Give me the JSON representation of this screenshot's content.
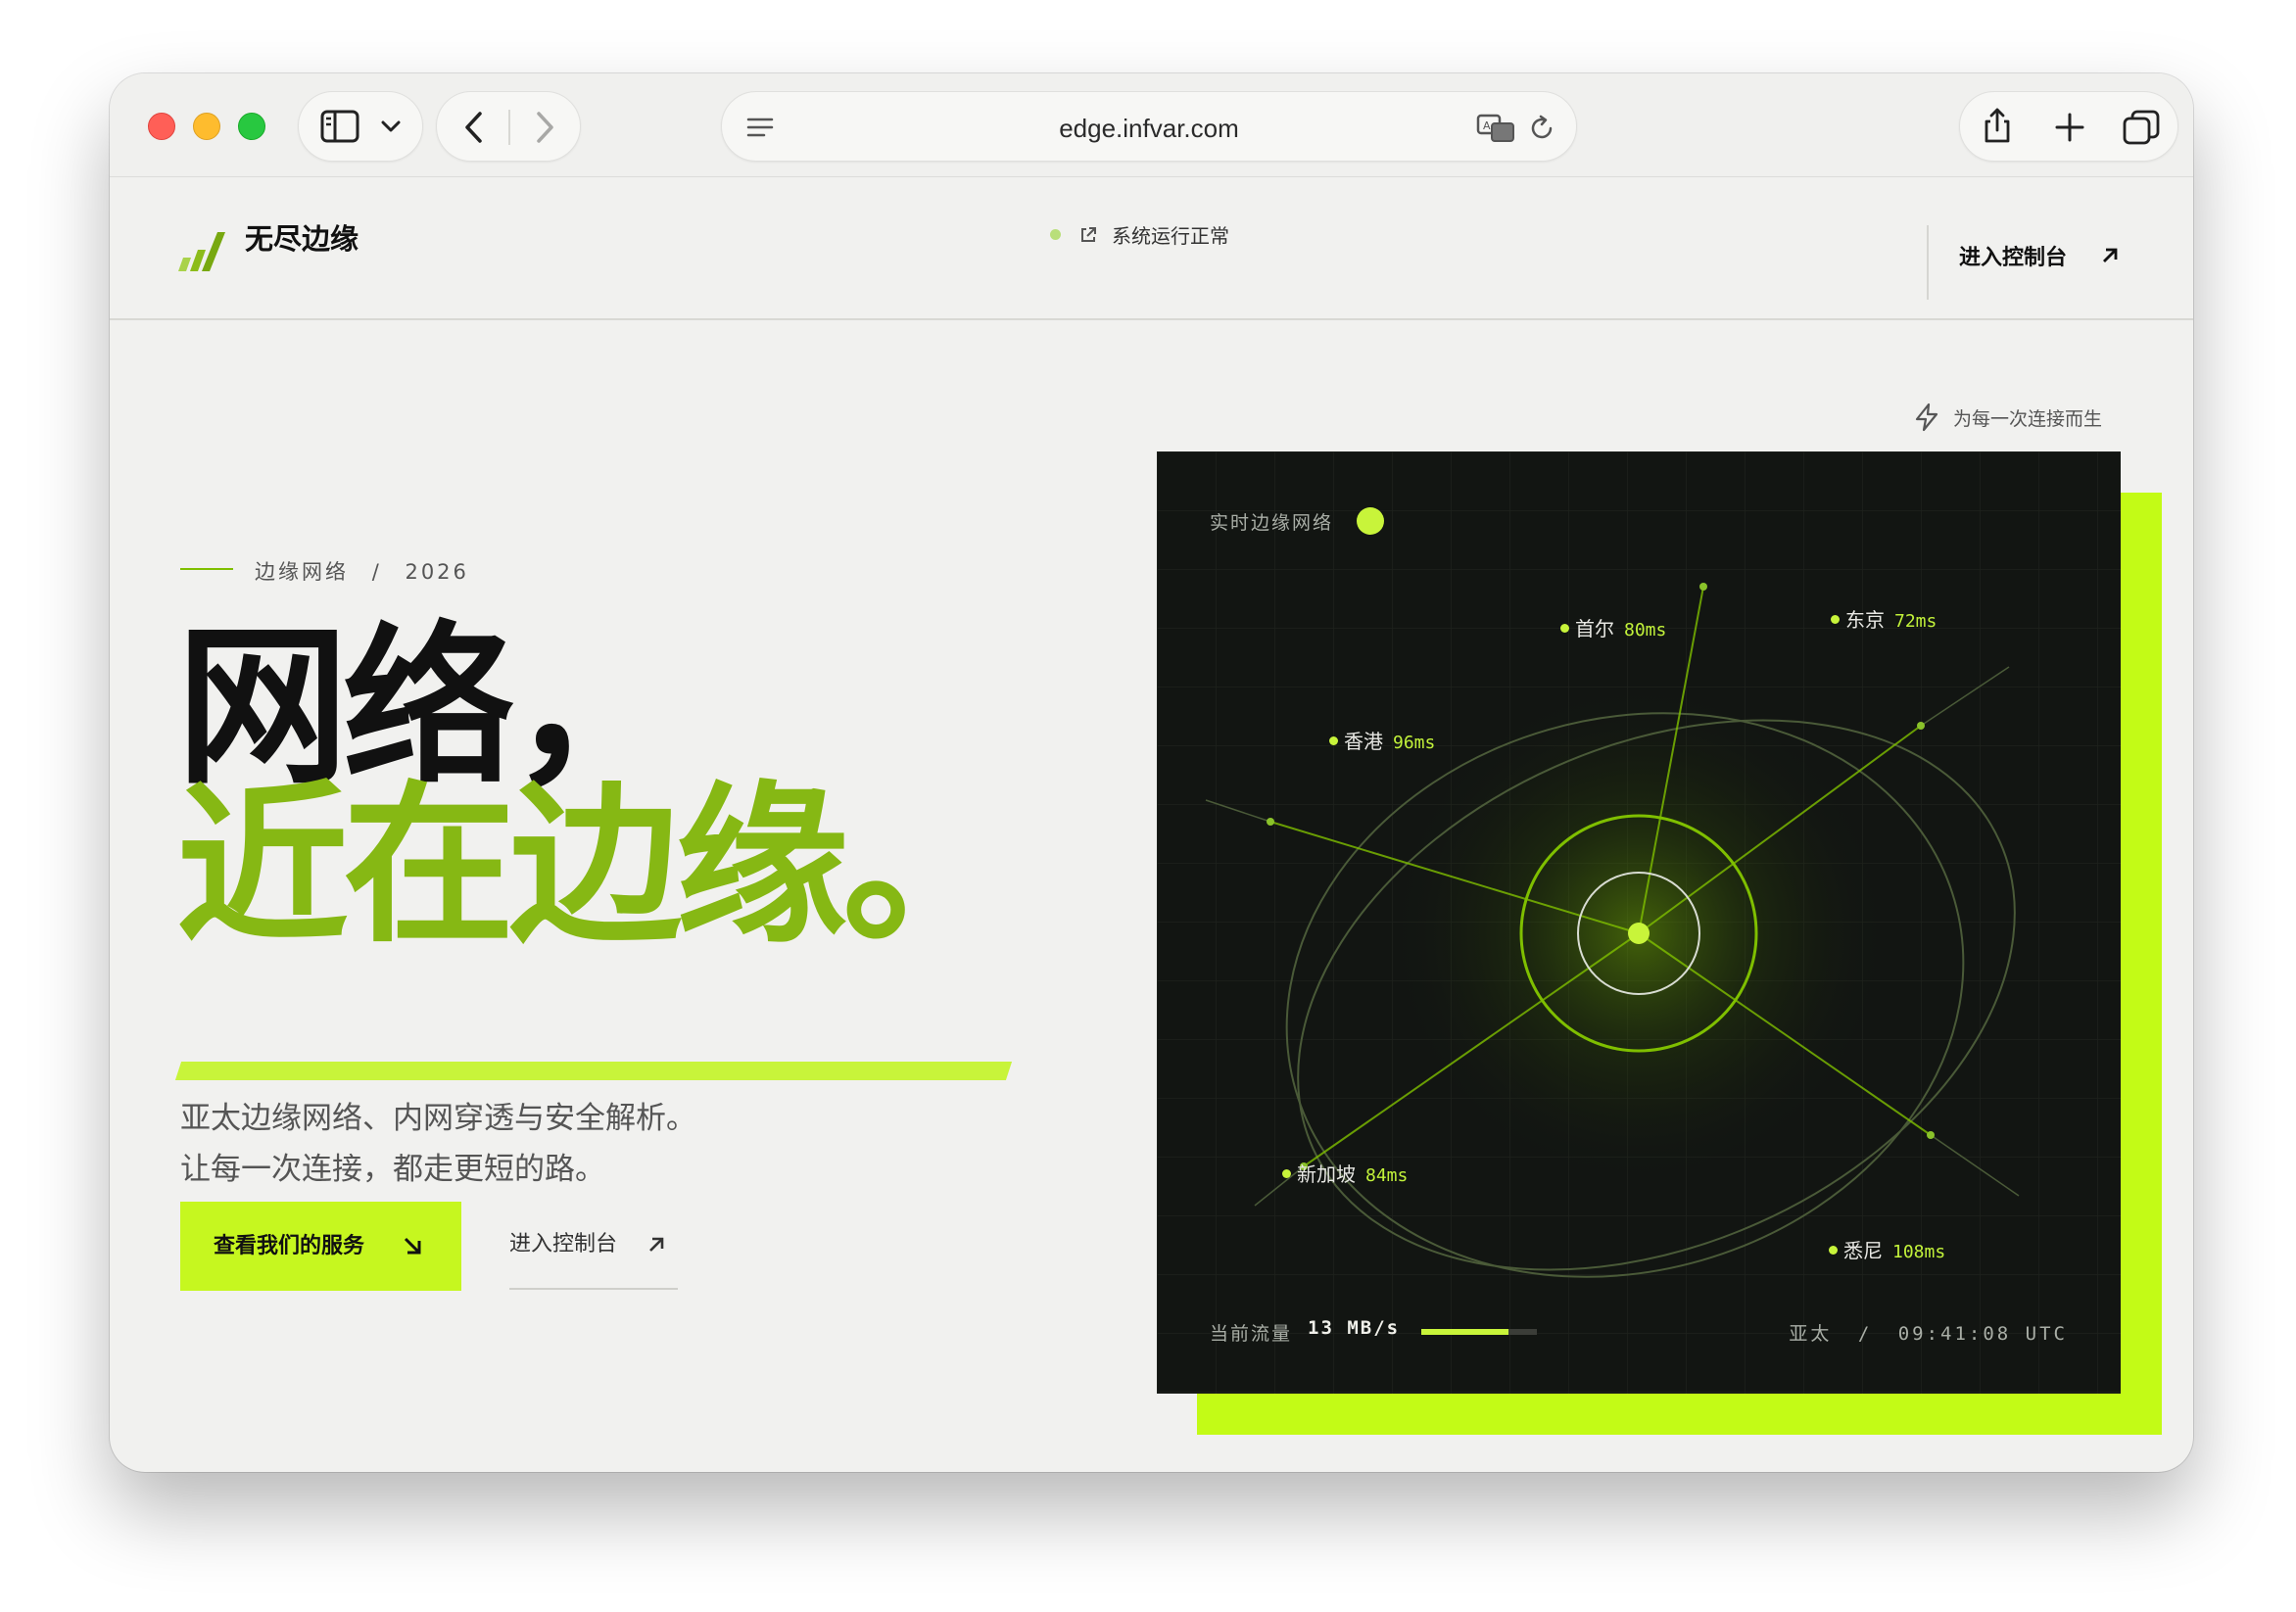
{
  "browser": {
    "url": "edge.infvar.com"
  },
  "site": {
    "brand": "无尽边缘",
    "status": "系统运行正常",
    "console_link": "进入控制台"
  },
  "hero": {
    "eyebrow_label": "边缘网络",
    "eyebrow_sep": "/",
    "eyebrow_year": "2026",
    "title_line1": "网络，",
    "title_line2": "近在边缘。",
    "subtitle_line1": "亚太边缘网络、内网穿透与安全解析。",
    "subtitle_line2": "让每一次连接，都走更短的路。",
    "primary_button": "查看我们的服务",
    "secondary_button": "进入控制台",
    "tagline": "为每一次连接而生"
  },
  "panel": {
    "title": "实时边缘网络",
    "cities": [
      {
        "name": "首尔",
        "latency": "80ms"
      },
      {
        "name": "东京",
        "latency": "72ms"
      },
      {
        "name": "香港",
        "latency": "96ms"
      },
      {
        "name": "新加坡",
        "latency": "84ms"
      },
      {
        "name": "悉尼",
        "latency": "108ms"
      }
    ],
    "traffic_label": "当前流量",
    "traffic_value": "13 MB/s",
    "traffic_level": 0.75,
    "region": "亚太",
    "region_sep": "/",
    "time": "09:41:08 UTC"
  },
  "colors": {
    "accent": "#c6f71f",
    "accent_dark": "#86b814",
    "panel_bg": "#121512"
  }
}
